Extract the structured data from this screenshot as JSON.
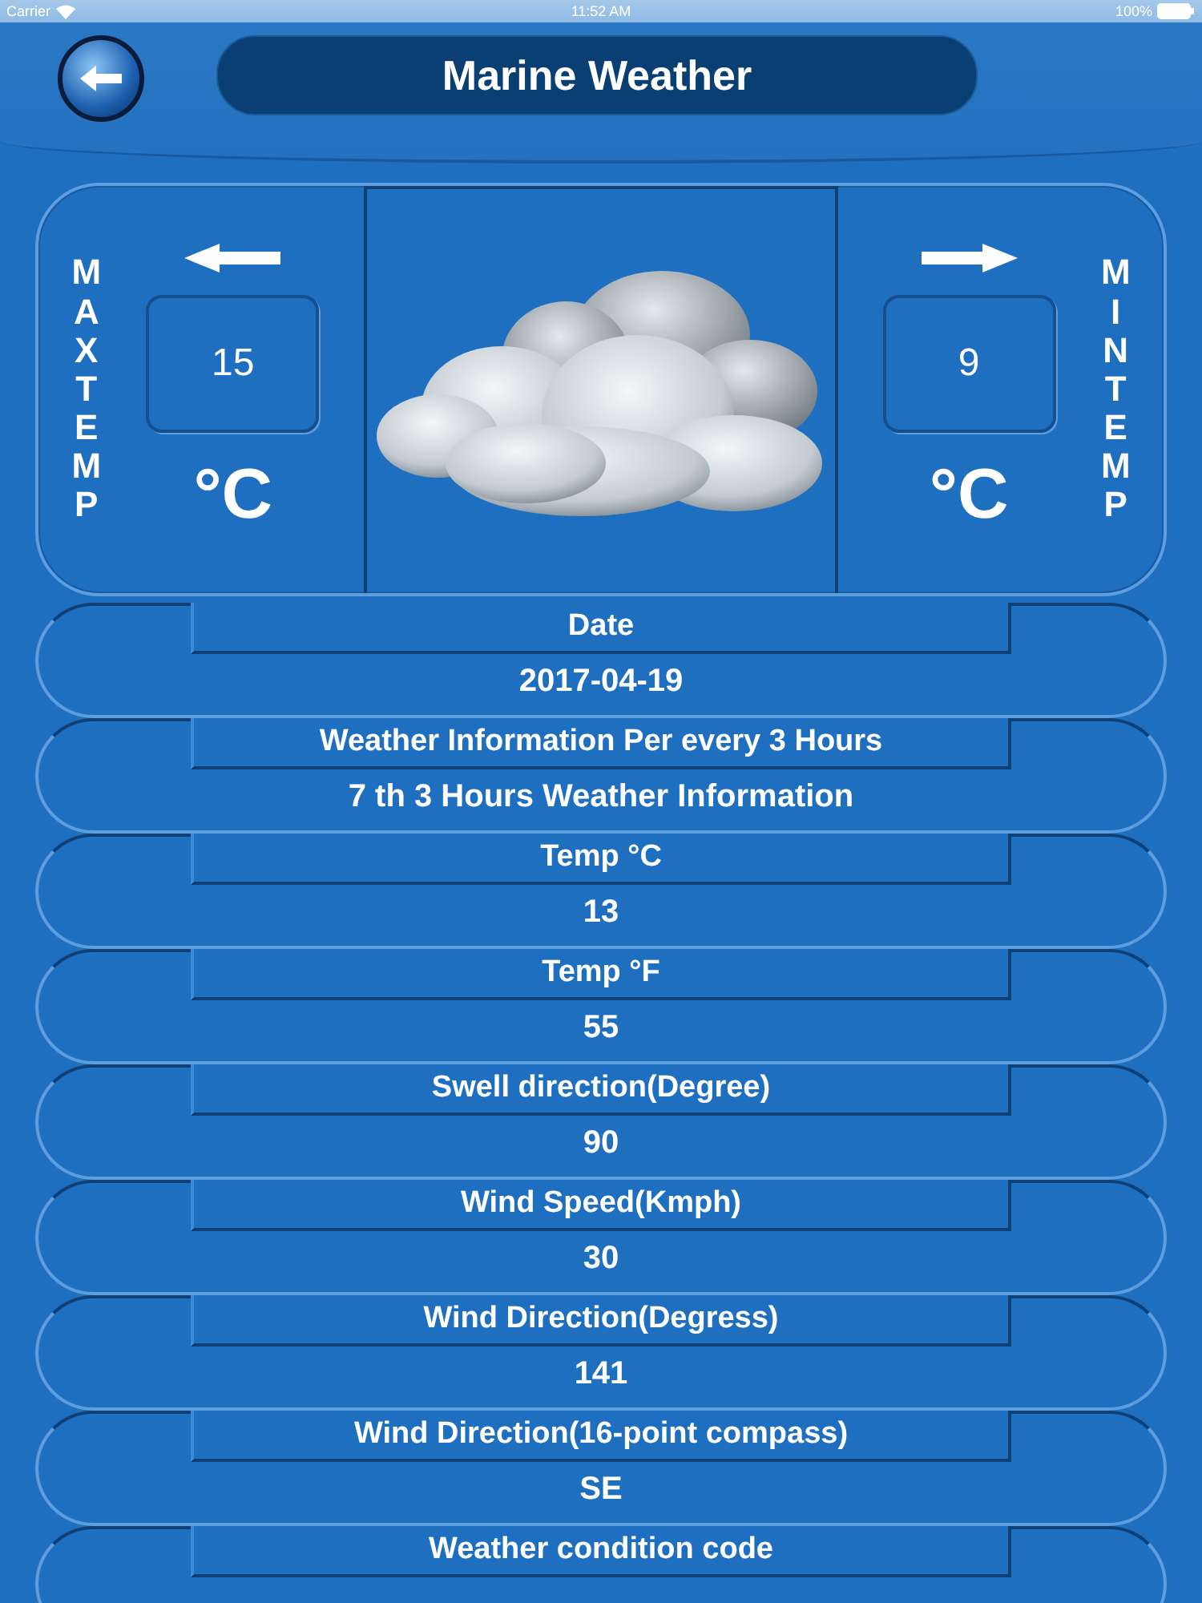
{
  "status_bar": {
    "carrier": "Carrier",
    "time": "11:52 AM",
    "battery": "100%"
  },
  "header": {
    "title": "Marine Weather"
  },
  "temperature": {
    "max": {
      "label": "MAX TEMP",
      "value": "15",
      "unit": "°C"
    },
    "min": {
      "label": "MIN TEMP",
      "value": "9",
      "unit": "°C"
    }
  },
  "rows": [
    {
      "label": "Date",
      "value": "2017-04-19"
    },
    {
      "label": "Weather Information Per every 3 Hours",
      "value": "7 th 3 Hours Weather Information"
    },
    {
      "label": "Temp °C",
      "value": "13"
    },
    {
      "label": "Temp °F",
      "value": "55"
    },
    {
      "label": "Swell direction(Degree)",
      "value": "90"
    },
    {
      "label": "Wind Speed(Kmph)",
      "value": "30"
    },
    {
      "label": "Wind Direction(Degress)",
      "value": "141"
    },
    {
      "label": "Wind Direction(16-point compass)",
      "value": "SE"
    },
    {
      "label": "Weather condition code"
    }
  ]
}
